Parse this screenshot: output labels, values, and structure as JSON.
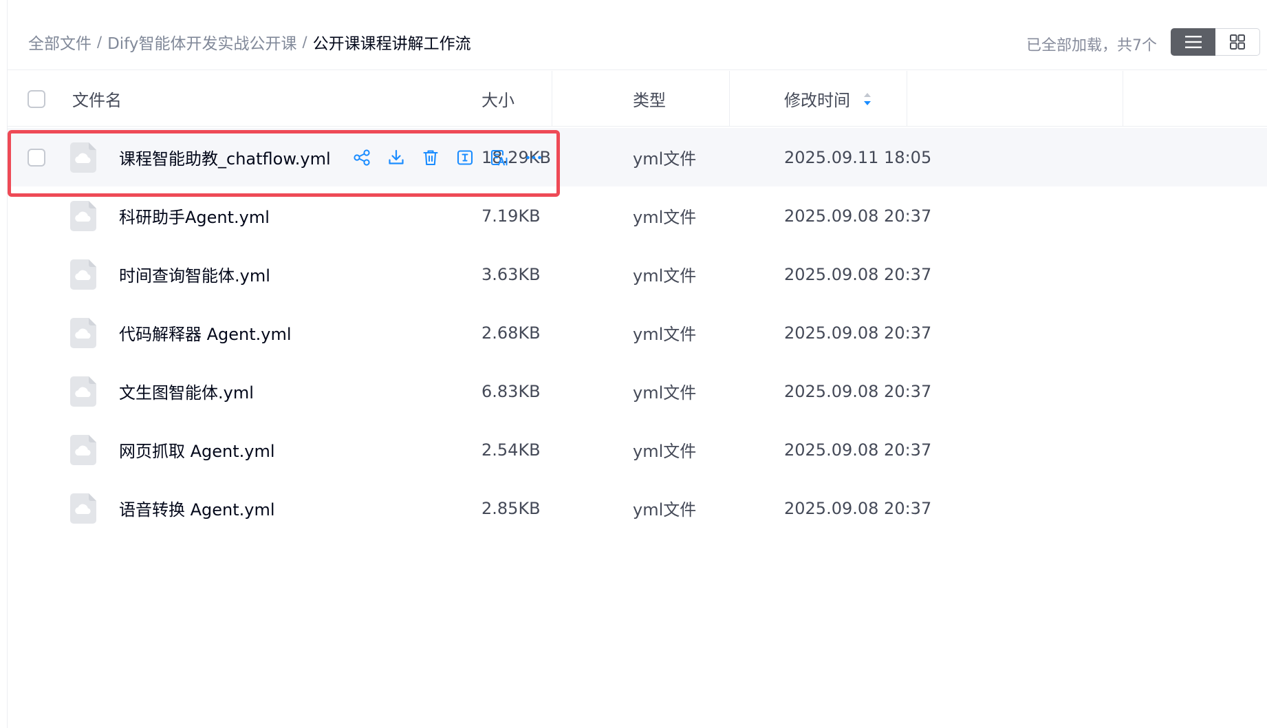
{
  "breadcrumb": {
    "root": "全部文件",
    "folder": "Dify智能体开发实战公开课",
    "current": "公开课课程讲解工作流",
    "separator": "/"
  },
  "load_status": "已全部加载，共7个",
  "view_toggle": {
    "active": "list",
    "icons": [
      "list-view-icon",
      "grid-view-icon"
    ]
  },
  "table": {
    "headers": {
      "name": "文件名",
      "size": "大小",
      "type": "类型",
      "modified": "修改时间"
    },
    "sort": {
      "column": "modified",
      "icon": "sort-caret-icon"
    },
    "rows": [
      {
        "name": "课程智能助教_chatflow.yml",
        "size": "18.29KB",
        "type": "yml文件",
        "modified": "2025.09.11 18:05"
      },
      {
        "name": "科研助手Agent.yml",
        "size": "7.19KB",
        "type": "yml文件",
        "modified": "2025.09.08 20:37"
      },
      {
        "name": "时间查询智能体.yml",
        "size": "3.63KB",
        "type": "yml文件",
        "modified": "2025.09.08 20:37"
      },
      {
        "name": "代码解释器 Agent.yml",
        "size": "2.68KB",
        "type": "yml文件",
        "modified": "2025.09.08 20:37"
      },
      {
        "name": "文生图智能体.yml",
        "size": "6.83KB",
        "type": "yml文件",
        "modified": "2025.09.08 20:37"
      },
      {
        "name": "网页抓取 Agent.yml",
        "size": "2.54KB",
        "type": "yml文件",
        "modified": "2025.09.08 20:37"
      },
      {
        "name": "语音转换 Agent.yml",
        "size": "2.85KB",
        "type": "yml文件",
        "modified": "2025.09.08 20:37"
      }
    ]
  },
  "row_actions": [
    "share-icon",
    "download-icon",
    "delete-icon",
    "rename-icon",
    "ai-summary-icon",
    "more-icon"
  ],
  "colors": {
    "accent": "#1a8cff",
    "highlight": "#ee4a56",
    "file_icon": "#e3e5e9",
    "hover_row": "#f6f7fa"
  }
}
